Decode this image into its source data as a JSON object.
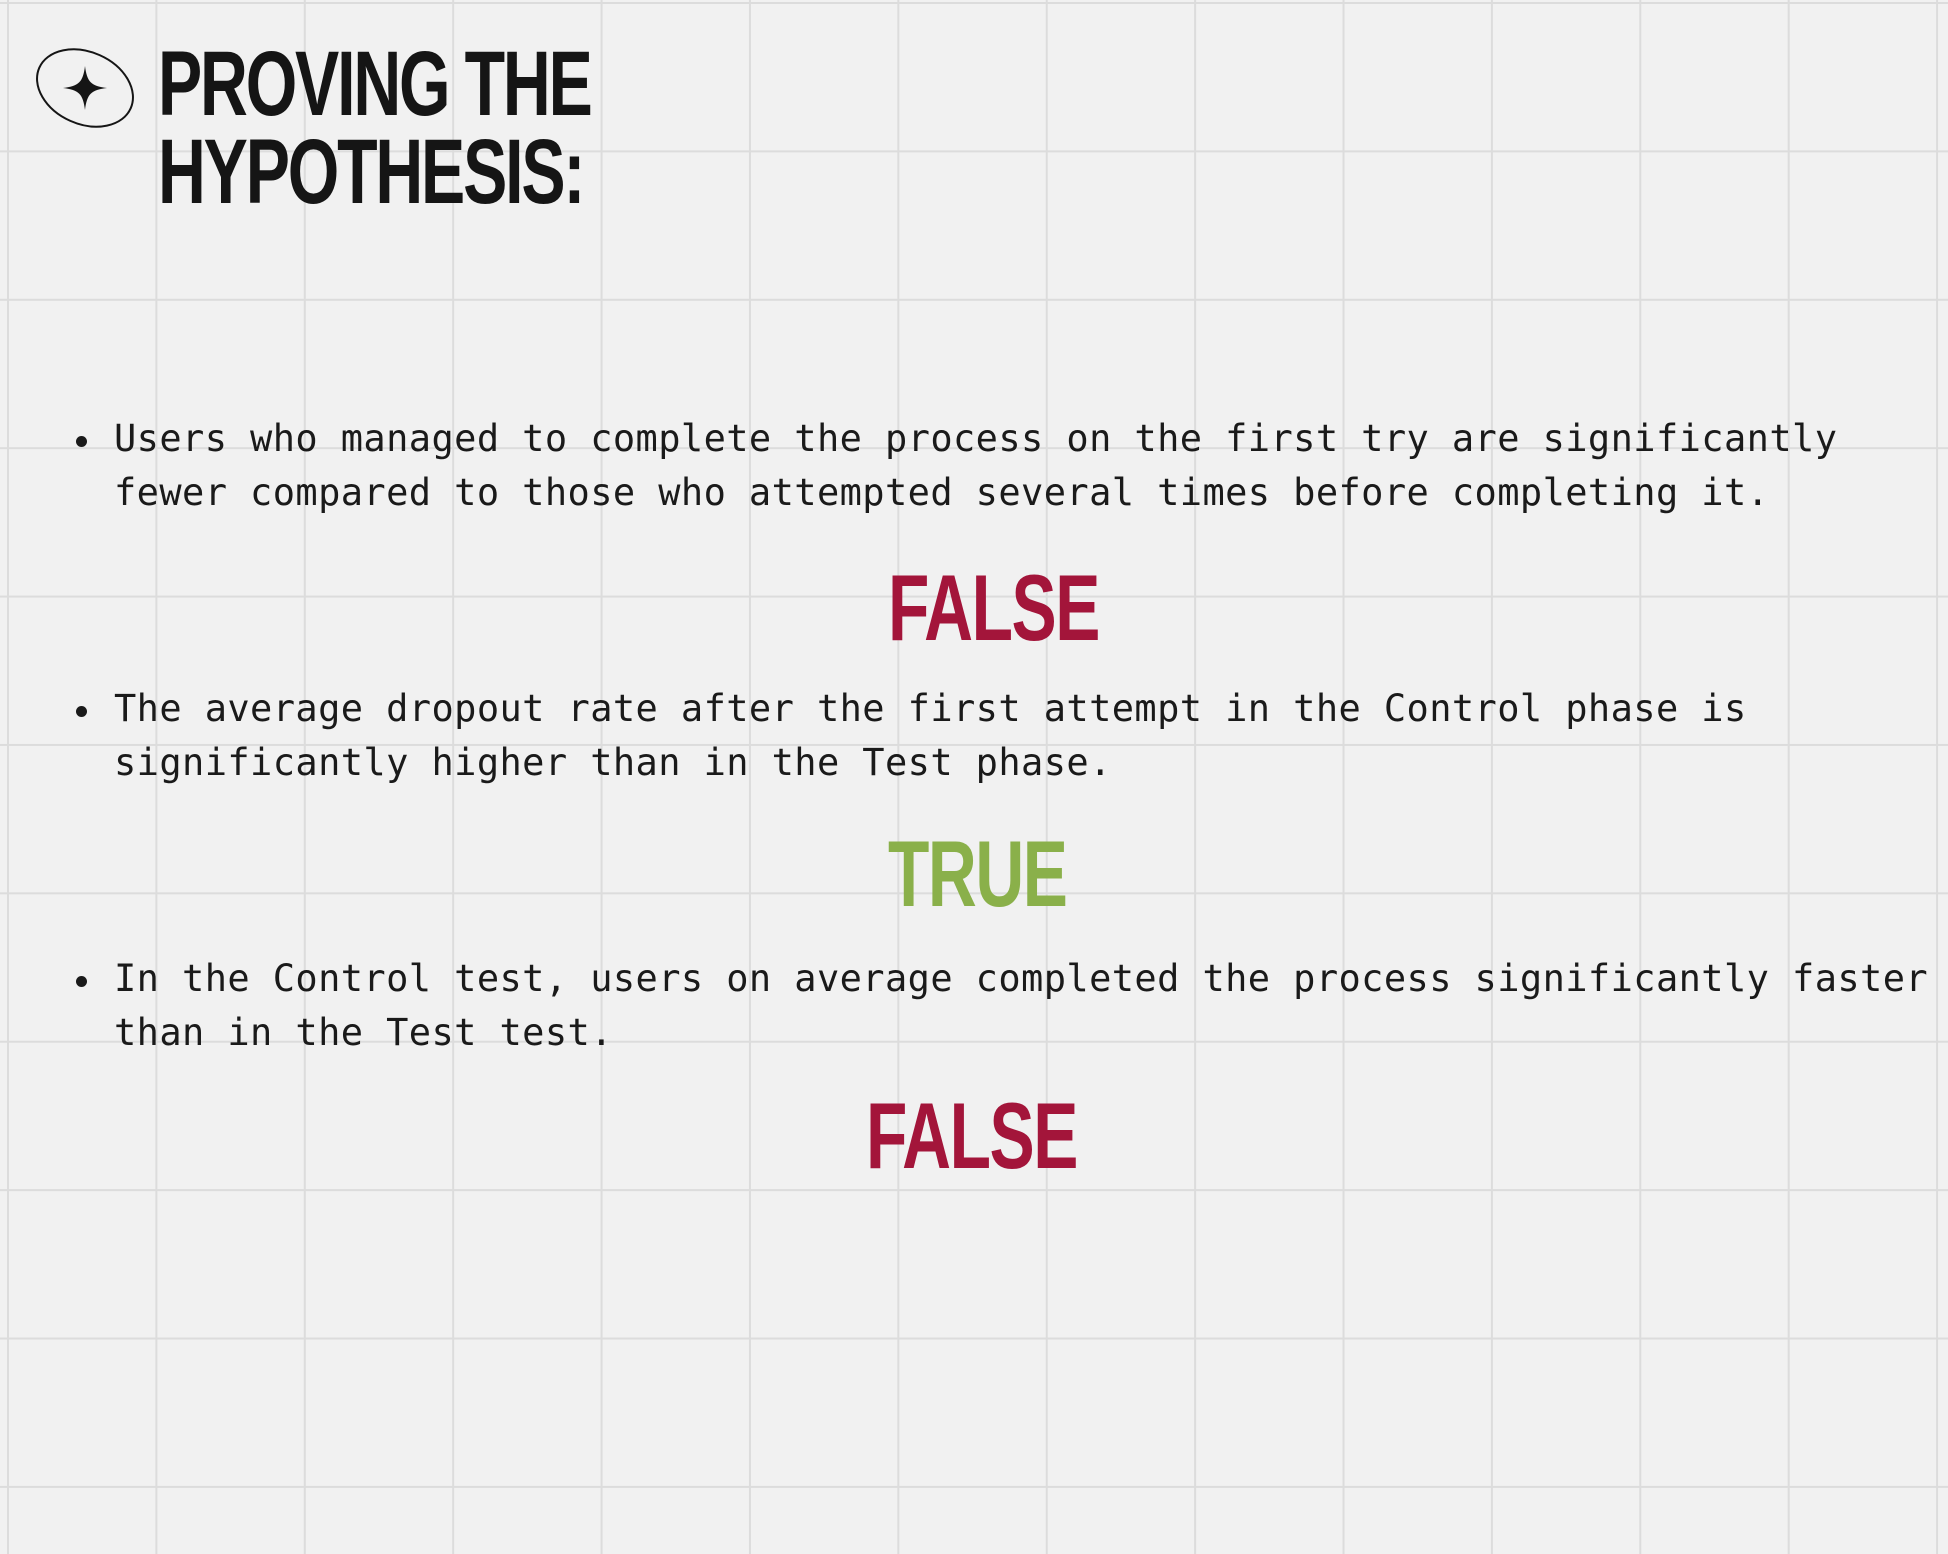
{
  "title": "PROVING THE HYPOTHESIS:",
  "header_icon": "four-point-star-orbit-icon",
  "colors": {
    "false": "#a3153a",
    "true": "#8ab04a",
    "text": "#1a1a1a",
    "background": "#f1f1f1",
    "grid": "#dcdcdc"
  },
  "hypotheses": [
    {
      "text": "Users who managed to complete the process on the first try are significantly fewer compared to those who attempted several times before completing it.",
      "verdict": "FALSE"
    },
    {
      "text": "The average dropout rate after the first attempt in the Control phase is significantly higher than in the Test phase.",
      "verdict": "TRUE"
    },
    {
      "text": "In the Control test, users on average completed the process significantly faster than in the Test test.",
      "verdict": "FALSE"
    }
  ]
}
